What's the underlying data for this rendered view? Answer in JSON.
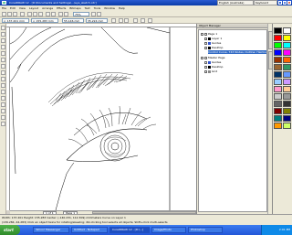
{
  "window": {
    "title": "CorelDRAW 12 - [D:\\Documents and Settings\\...\\eye_sketch.cdr]",
    "minimize": "_",
    "maximize": "□",
    "close": "x"
  },
  "langbar": {
    "language": "English (Australia)",
    "keyboard": "Keyboard"
  },
  "menu": [
    "File",
    "Edit",
    "View",
    "Layout",
    "Arrange",
    "Effects",
    "Bitmaps",
    "Text",
    "Tools",
    "Window",
    "Help"
  ],
  "toolbar": {
    "zoom": "75%",
    "x_pos": "x: 137.201 mm",
    "y_pos": "y: 155.283 mm",
    "width": "55.146 mm",
    "height": "35.224 mm"
  },
  "docker": {
    "title": "Object Manager",
    "objects": [
      {
        "label": "Page 1",
        "selected": false,
        "color": "#ffffff"
      },
      {
        "label": "Layer 1",
        "selected": false,
        "color": "#000000"
      },
      {
        "label": "Guides",
        "selected": false,
        "color": "#3355cc"
      },
      {
        "label": "Desktop",
        "selected": false,
        "color": "#000000"
      },
      {
        "label": "Control Curve, 743 Nodes, Outline: Hairline",
        "selected": true,
        "color": "#316ac5"
      },
      {
        "label": "Master Page",
        "selected": false,
        "color": "#ffffff"
      },
      {
        "label": "Guides",
        "selected": false,
        "color": "#3355cc"
      },
      {
        "label": "Desktop",
        "selected": false,
        "color": "#000000"
      },
      {
        "label": "Grid",
        "selected": false,
        "color": "#888888"
      }
    ]
  },
  "page_nav": {
    "counter": "1 of 1",
    "tab": "Page 1"
  },
  "status": {
    "line1": "Width: 137.201 Height: 155.283 Center: (-140.231, 112.309) millimeters      Curve on Layer 1",
    "line2": "(139.284, 44.283)     Click an object twice for rotating/skewing; dbl-clicking tool selects all objects; Shift+click multi-selects"
  },
  "taskbar": {
    "start": "start",
    "tasks": [
      "Yahoo! Messenger",
      "Untitled - Notepad",
      "CorelDRAW 12 - [D:\\...]",
      "Image/Photo",
      "Photoshop"
    ],
    "clock": "2:01 PM"
  },
  "palette_colors": [
    "#000000",
    "#ffffff",
    "#ff0000",
    "#ffff00",
    "#00ff00",
    "#00ffff",
    "#0000ff",
    "#ff00ff",
    "#993300",
    "#ff6600",
    "#996633",
    "#339966",
    "#003366",
    "#6699ff",
    "#99ccff",
    "#cc99ff",
    "#ff99cc",
    "#ffcc99",
    "#cccccc",
    "#999999",
    "#666666",
    "#333333",
    "#800000",
    "#808000",
    "#008080",
    "#000080",
    "#ff9900",
    "#ccff66"
  ]
}
